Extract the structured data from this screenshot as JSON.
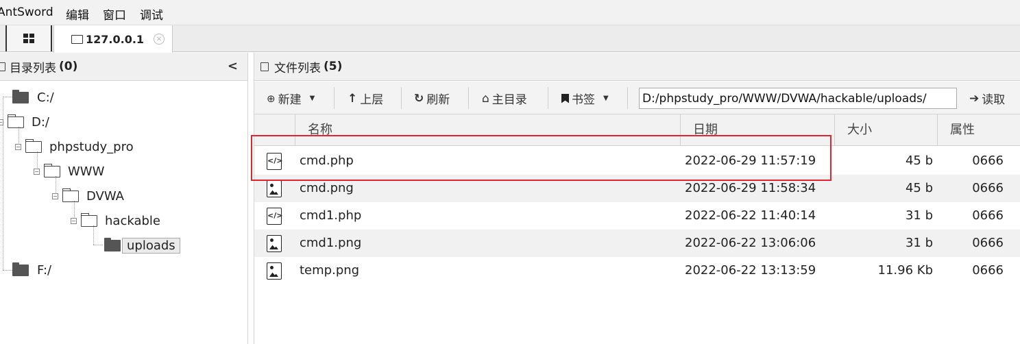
{
  "menubar": {
    "items": [
      "AntSword",
      "编辑",
      "窗口",
      "调试"
    ]
  },
  "tabs": {
    "host_label": "127.0.0.1",
    "close_glyph": "×"
  },
  "left_panel": {
    "title": "目录列表",
    "count": "(0)",
    "collapse_glyph": "<",
    "tree": [
      {
        "label": "C:/"
      },
      {
        "label": "D:/"
      },
      {
        "label": "phpstudy_pro"
      },
      {
        "label": "WWW"
      },
      {
        "label": "DVWA"
      },
      {
        "label": "hackable"
      },
      {
        "label": "uploads"
      },
      {
        "label": "F:/"
      }
    ]
  },
  "right_panel": {
    "title": "文件列表",
    "count": "(5)",
    "toolbar": {
      "new_label": "新建",
      "up_label": "上层",
      "refresh_label": "刷新",
      "home_label": "主目录",
      "bookmark_label": "书签",
      "read_label": "读取",
      "path_value": "D:/phpstudy_pro/WWW/DVWA/hackable/uploads/"
    },
    "columns": [
      "名称",
      "日期",
      "大小",
      "属性"
    ],
    "files": [
      {
        "name": "cmd.php",
        "date": "2022-06-29 11:57:19",
        "size": "45 b",
        "attr": "0666",
        "icon": "code-file-icon"
      },
      {
        "name": "cmd.png",
        "date": "2022-06-29 11:58:34",
        "size": "45 b",
        "attr": "0666",
        "icon": "image-file-icon"
      },
      {
        "name": "cmd1.php",
        "date": "2022-06-22 11:40:14",
        "size": "31 b",
        "attr": "0666",
        "icon": "code-file-icon"
      },
      {
        "name": "cmd1.png",
        "date": "2022-06-22 13:06:06",
        "size": "31 b",
        "attr": "0666",
        "icon": "image-file-icon"
      },
      {
        "name": "temp.png",
        "date": "2022-06-22 13:13:59",
        "size": "11.96 Kb",
        "attr": "0666",
        "icon": "image-file-icon"
      }
    ]
  },
  "colors": {
    "highlight": "#e0242e"
  }
}
